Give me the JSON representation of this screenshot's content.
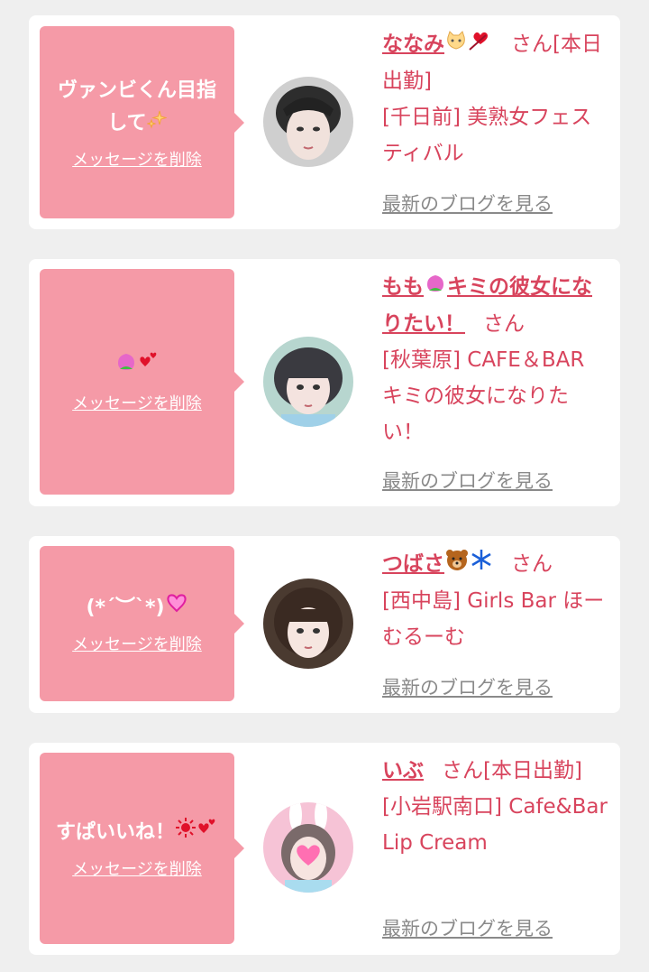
{
  "common": {
    "delete_label": "メッセージを削除",
    "blog_label": "最新のブログを見る",
    "san": "さん"
  },
  "cards": [
    {
      "message": "ヴァンビくん目指して",
      "message_emoji": "sparkles",
      "name": "ななみ",
      "name_emoji": "cat-face, heart-arrow",
      "san_suffix": "さん[本日出勤]",
      "shop": "[千日前] 美熟女フェスティバル"
    },
    {
      "message": "",
      "message_emoji": "peach, hearts",
      "name": "もも",
      "name_suffix": "キミの彼女になりたい！",
      "san_suffix": "さん",
      "shop": "[秋葉原] CAFE＆BAR キミの彼女になりたい！"
    },
    {
      "message": "(*´︶`*)",
      "message_emoji": "heart",
      "name": "つばさ",
      "name_emoji": "bear, snowflake",
      "san_suffix": "さん",
      "shop": "[西中島] Girls Bar ほーむるーむ"
    },
    {
      "message": "すぱいいね！",
      "message_emoji": "sun, hearts",
      "name": "いぶ",
      "san_suffix": "さん[本日出勤]",
      "shop": "[小岩駅南口] Cafe&Bar Lip Cream"
    }
  ],
  "colors": {
    "bubble": "#f59aa7",
    "accent": "#d8445d",
    "blog_link": "#8a8a8a",
    "background": "#efefef"
  }
}
